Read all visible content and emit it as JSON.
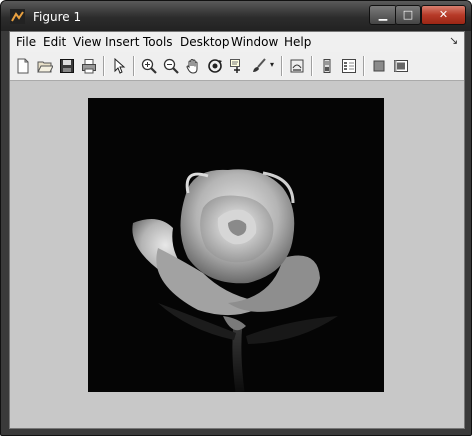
{
  "window": {
    "title": "Figure 1",
    "buttons": {
      "minimize": "▁",
      "maximize": "□",
      "close": "✕"
    }
  },
  "menubar": {
    "items": [
      "File",
      "Edit",
      "View",
      "Insert",
      "Tools",
      "Desktop",
      "Window",
      "Help"
    ],
    "overflow_icon": "dock-arrow-icon"
  },
  "toolbar": {
    "tools": [
      "new-figure-icon",
      "open-file-icon",
      "save-icon",
      "print-icon",
      "select-arrow-icon",
      "zoom-in-icon",
      "zoom-out-icon",
      "pan-hand-icon",
      "rotate-3d-icon",
      "data-cursor-icon",
      "brush-icon",
      "link-plot-icon",
      "colorbar-icon",
      "legend-icon",
      "hide-plot-tools-icon",
      "show-plot-tools-icon"
    ]
  },
  "figure": {
    "background": "#c8c8c8",
    "content": "grayscale image of a rose on black background"
  }
}
